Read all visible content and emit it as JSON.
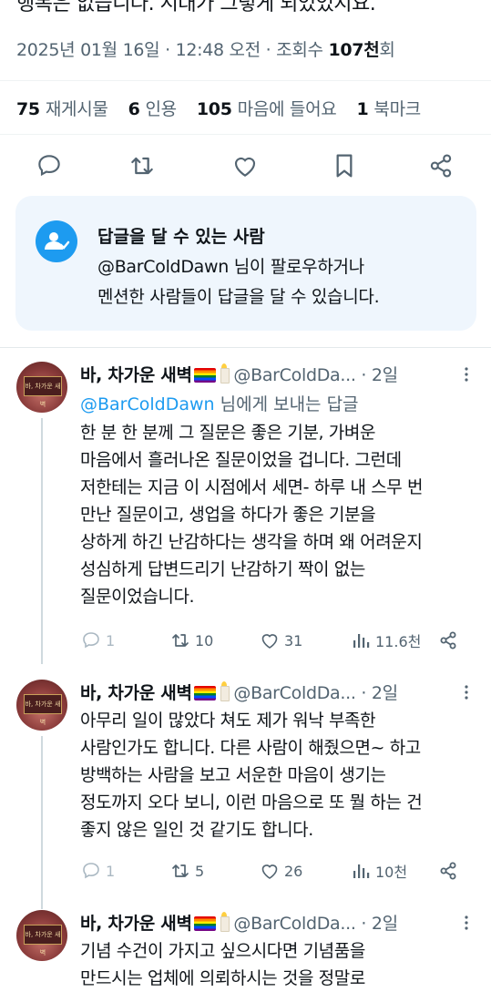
{
  "detail": {
    "cut_text": "행복은 없습니다. 시대가 그렇게 되었었지요.",
    "date": "2025년 01월 16일",
    "time": "12:48 오전",
    "views_label": "조회수",
    "views_value": "107천",
    "views_suffix": "회",
    "stats": {
      "reposts_count": "75",
      "reposts_label": "재게시물",
      "quotes_count": "6",
      "quotes_label": "인용",
      "likes_count": "105",
      "likes_label": "마음에 들어요",
      "bookmarks_count": "1",
      "bookmarks_label": "북마크"
    },
    "actions": [
      "reply-icon",
      "repost-icon",
      "like-icon",
      "bookmark-icon",
      "share-icon"
    ]
  },
  "reply_restriction": {
    "title": "답글을 달 수 있는 사람",
    "line1": "@BarColdDawn 님이 팔로우하거나",
    "line2": "멘션한 사람들이 답글을 달 수 있습니다.",
    "icon": "person-check-icon"
  },
  "replies": [
    {
      "name": "바, 차가운 새벽",
      "handle": "@BarColdDa...",
      "age": "· 2일",
      "replying_to_user": "@BarColdDawn",
      "replying_to_suffix": " 님에게 보내는 답글",
      "lines": [
        "한 분 한 분께 그 질문은 좋은 기분, 가벼운",
        "마음에서 흘러나온 질문이었을 겁니다. 그런데",
        "저한테는 지금 이 시점에서 세면- 하루 내 스무 번",
        "만난 질문이고, 생업을 하다가 좋은 기분을",
        "상하게 하긴 난감하다는 생각을 하며 왜 어려운지",
        "성심하게 답변드리기 난감하기 짝이 없는",
        "질문이었습니다."
      ],
      "replies": "1",
      "reposts": "10",
      "likes": "31",
      "views": "11.6천"
    },
    {
      "name": "바, 차가운 새벽",
      "handle": "@BarColdDa...",
      "age": "· 2일",
      "lines": [
        "아무리 일이 많았다 쳐도 제가 워낙 부족한",
        "사람인가도 합니다. 다른 사람이 해줬으면~ 하고",
        "방백하는 사람을 보고 서운한 마음이 생기는",
        "정도까지 오다 보니, 이런 마음으로 또 뭘 하는 건",
        "좋지 않은 일인 것 같기도 합니다."
      ],
      "replies": "1",
      "reposts": "5",
      "likes": "26",
      "views": "10천"
    },
    {
      "name": "바, 차가운 새벽",
      "handle": "@BarColdDa...",
      "age": "· 2일",
      "lines": [
        "기념 수건이 가지고 싶으시다면 기념품을",
        "만드시는 업체에 의뢰하시는 것을 정말로"
      ]
    }
  ],
  "colors": {
    "accent": "#1d9bf0",
    "muted": "#536471",
    "text": "#0f1419",
    "reply_box_bg": "#eff6fd"
  }
}
